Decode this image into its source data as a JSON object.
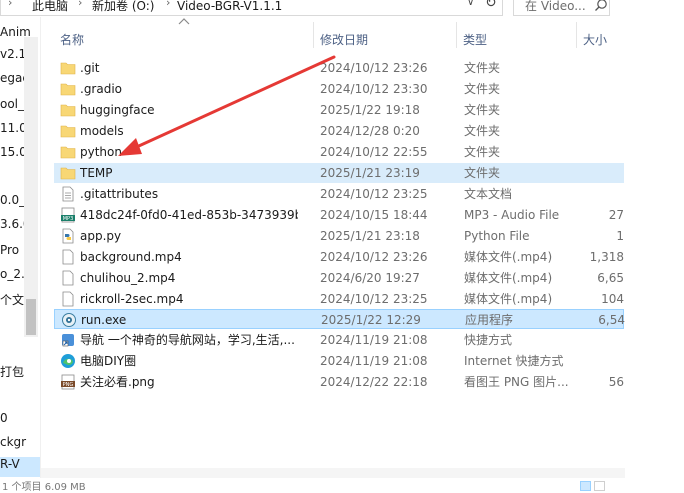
{
  "address": {
    "crumbs": [
      "此电脑",
      "新加卷 (O:)",
      "Video-BGR-V1.1.1"
    ],
    "search_placeholder": "在 Video..."
  },
  "nav": {
    "items": [
      "Anim",
      "v2.1",
      "egac",
      "ool_",
      "11.0",
      "15.0",
      "",
      "0.0_l",
      "3.6.0",
      "Pro",
      "o_2.",
      "个文",
      "",
      "",
      "打包",
      "",
      "0",
      "ckgr",
      "R-V"
    ]
  },
  "columns": {
    "name": "名称",
    "date": "修改日期",
    "type": "类型",
    "size": "大小"
  },
  "files": [
    {
      "name": ".git",
      "date": "2024/10/12 23:26",
      "type": "文件夹",
      "size": "",
      "icon": "folder"
    },
    {
      "name": ".gradio",
      "date": "2024/10/12 23:30",
      "type": "文件夹",
      "size": "",
      "icon": "folder"
    },
    {
      "name": "huggingface",
      "date": "2025/1/22 19:18",
      "type": "文件夹",
      "size": "",
      "icon": "folder"
    },
    {
      "name": "models",
      "date": "2024/12/28 0:20",
      "type": "文件夹",
      "size": "",
      "icon": "folder"
    },
    {
      "name": "python",
      "date": "2024/10/12 22:55",
      "type": "文件夹",
      "size": "",
      "icon": "folder"
    },
    {
      "name": "TEMP",
      "date": "2025/1/21 23:19",
      "type": "文件夹",
      "size": "",
      "icon": "folder"
    },
    {
      "name": ".gitattributes",
      "date": "2024/10/12 23:25",
      "type": "文本文档",
      "size": "",
      "icon": "text"
    },
    {
      "name": "418dc24f-0fd0-41ed-853b-3473939b...",
      "date": "2024/10/15 18:44",
      "type": "MP3 - Audio File",
      "size": "27",
      "icon": "mp3"
    },
    {
      "name": "app.py",
      "date": "2025/1/21 23:18",
      "type": "Python File",
      "size": "1",
      "icon": "python"
    },
    {
      "name": "background.mp4",
      "date": "2024/10/12 23:26",
      "type": "媒体文件(.mp4)",
      "size": "1,318",
      "icon": "media"
    },
    {
      "name": "chulihou_2.mp4",
      "date": "2024/6/20 19:27",
      "type": "媒体文件(.mp4)",
      "size": "6,65",
      "icon": "media"
    },
    {
      "name": "rickroll-2sec.mp4",
      "date": "2024/10/12 23:25",
      "type": "媒体文件(.mp4)",
      "size": "104",
      "icon": "media"
    },
    {
      "name": "run.exe",
      "date": "2025/1/22 12:29",
      "type": "应用程序",
      "size": "6,54",
      "icon": "exe"
    },
    {
      "name": "导航   一个神奇的导航网站，学习,生活,...",
      "date": "2024/11/19 21:08",
      "type": "快捷方式",
      "size": "",
      "icon": "shortcut"
    },
    {
      "name": "电脑DIY圈",
      "date": "2024/11/19 21:08",
      "type": "Internet 快捷方式",
      "size": "",
      "icon": "edge"
    },
    {
      "name": "关注必看.png",
      "date": "2024/12/22 22:18",
      "type": "看图王 PNG 图片...",
      "size": "56",
      "icon": "png"
    }
  ],
  "status": {
    "text": "1 个项目  6.09 MB"
  },
  "colors": {
    "selection": "#cce8ff",
    "folder": "#f8d775",
    "arrow": "#e53935"
  }
}
